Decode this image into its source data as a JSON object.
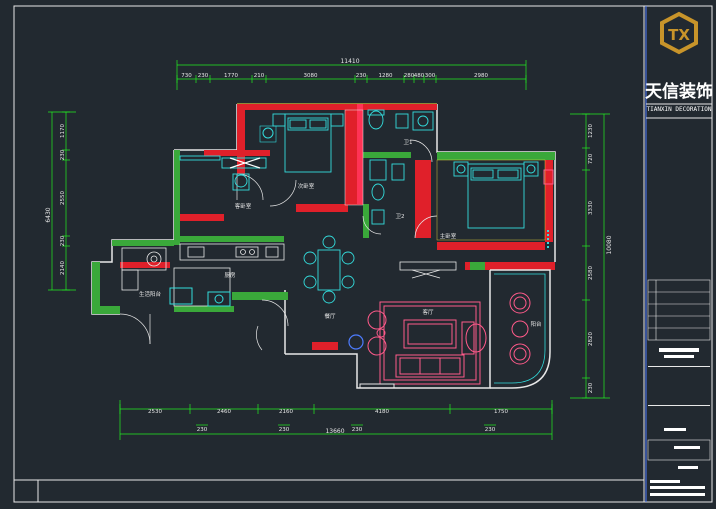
{
  "brand": {
    "logo_letters": "TX",
    "name_cn": "天信装饰",
    "name_en": "TIANXIN DECORATION"
  },
  "dims_top": {
    "overall": "11410",
    "segments": [
      "730",
      "230",
      "1770",
      "210",
      "3080",
      "230",
      "1280",
      "280",
      "480",
      "300",
      "2980"
    ]
  },
  "dims_bottom": {
    "overall": "13660",
    "row1": [
      "2530",
      "2460",
      "2160",
      "4180",
      "1750"
    ],
    "row2": [
      "230",
      "230",
      "230",
      "230"
    ]
  },
  "dims_left": {
    "overall": "6430",
    "segments": [
      "1170",
      "230",
      "2550",
      "230",
      "2140"
    ]
  },
  "dims_right": {
    "overall": "10080",
    "segments": [
      "1230",
      "720",
      "3330",
      "2580",
      "2820",
      "230"
    ]
  },
  "room_labels": {
    "master_bedroom": "主卧室",
    "second_bedroom": "次卧室",
    "guest_bedroom": "客卧室",
    "bathroom_1": "卫1",
    "bathroom_2": "卫2",
    "kitchen": "厨房",
    "living_room": "客厅",
    "dining": "餐厅",
    "balcony": "阳台",
    "utility": "生活阳台"
  },
  "colors": {
    "background": "#222930",
    "wall_red": "#e0202a",
    "wall_green": "#3aa83a",
    "dimension": "#22ee22",
    "furniture_cyan": "#33dddd",
    "furniture_white": "#e8e8e8",
    "sofa_pink": "#ff5a8a",
    "accent_gold": "#c8942a"
  }
}
